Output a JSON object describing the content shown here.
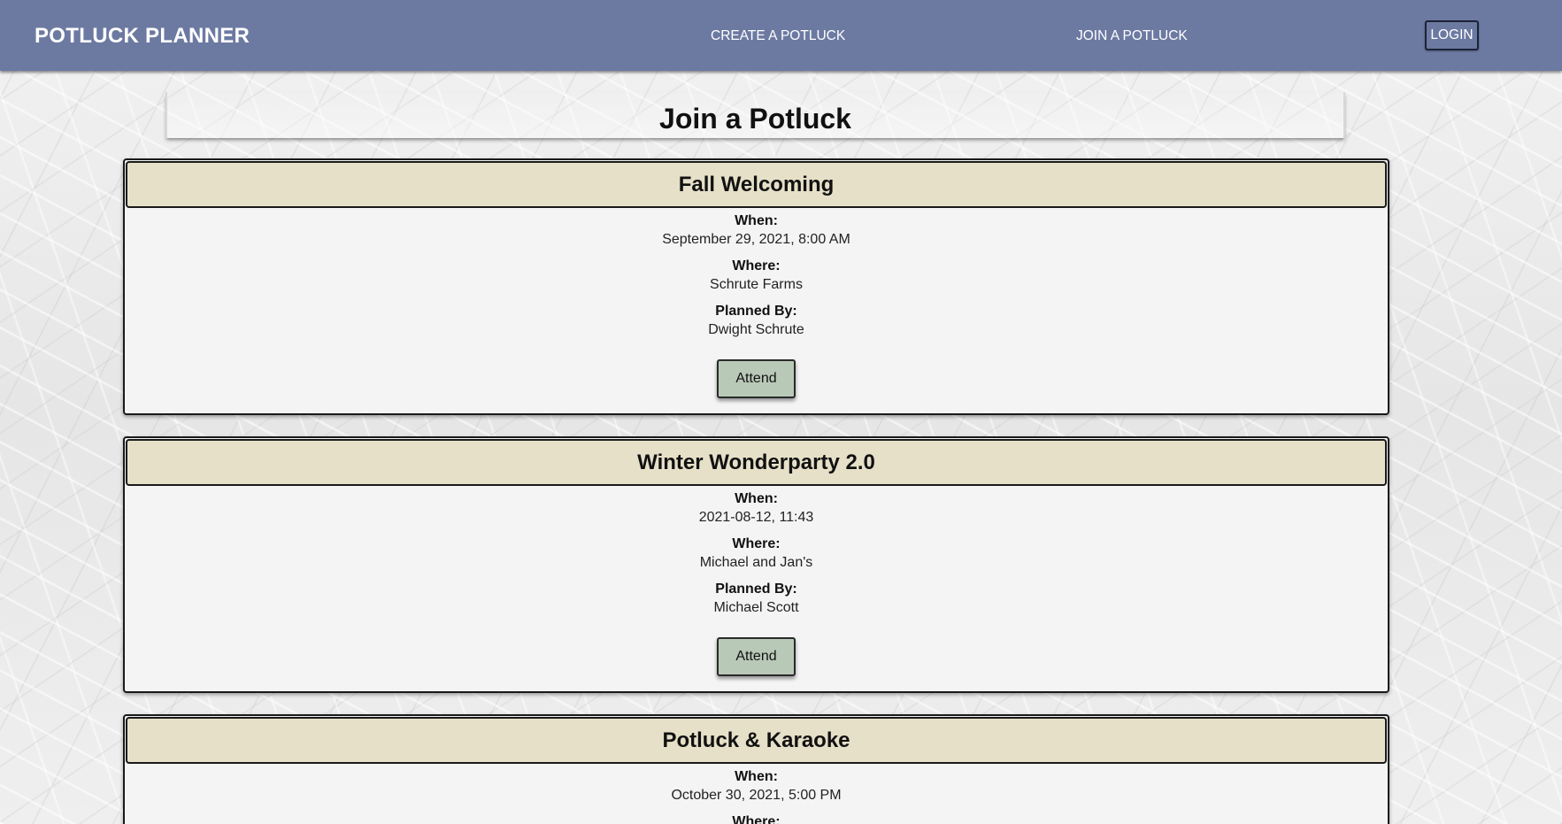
{
  "navbar": {
    "brand": "POTLUCK PLANNER",
    "links": [
      {
        "label": "CREATE A POTLUCK"
      },
      {
        "label": "JOIN A POTLUCK"
      }
    ],
    "login_label": "LOGIN",
    "color": "#6c7aa2"
  },
  "page": {
    "title": "Join a Potluck"
  },
  "labels": {
    "when": "When:",
    "where": "Where:",
    "planned_by": "Planned By:",
    "attend": "Attend"
  },
  "potlucks": [
    {
      "name": "Fall Welcoming",
      "when": "September 29, 2021, 8:00 AM",
      "where": "Schrute Farms",
      "planned_by": "Dwight Schrute"
    },
    {
      "name": "Winter Wonderparty 2.0",
      "when": "2021-08-12, 11:43",
      "where": "Michael and Jan's",
      "planned_by": "Michael Scott"
    },
    {
      "name": "Potluck & Karaoke",
      "when": "October 30, 2021, 5:00 PM",
      "where": "",
      "planned_by": ""
    }
  ],
  "colors": {
    "card_header": "#e6e0c8",
    "attend_button": "#b9c9b8",
    "card_body": "#f4f4f4"
  }
}
